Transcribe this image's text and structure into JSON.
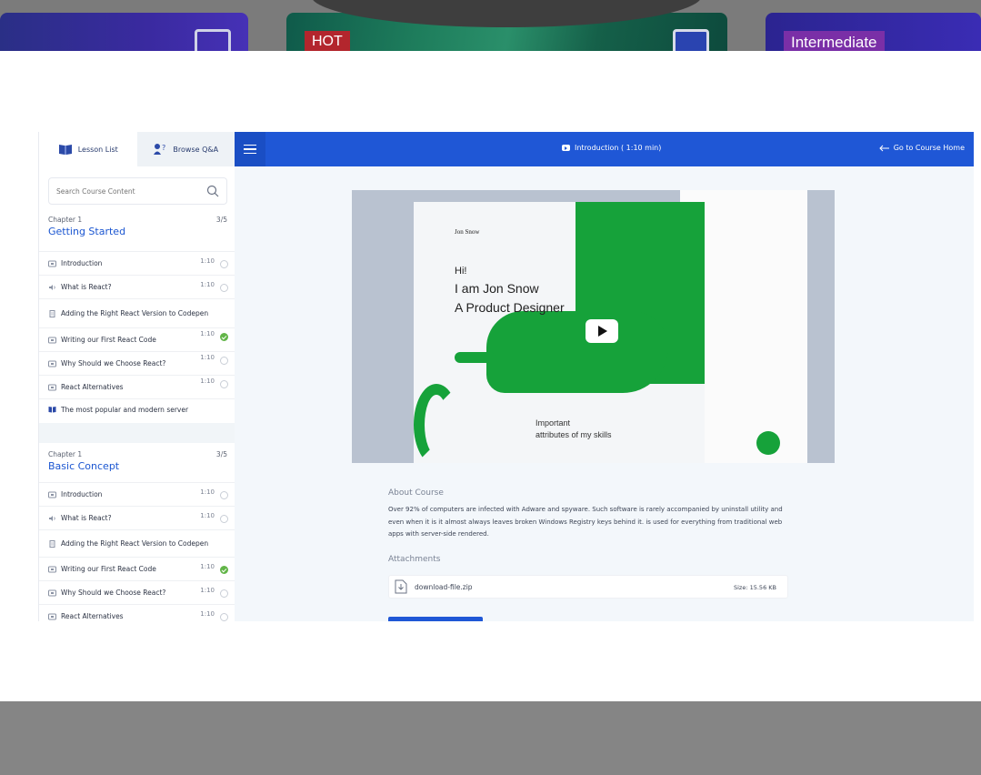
{
  "background": {
    "badges": {
      "hot": "HOT",
      "intermediate": "Intermediate"
    }
  },
  "tabs": [
    {
      "label": "Lesson List",
      "icon": "book-icon",
      "active": true
    },
    {
      "label": "Browse Q&A",
      "icon": "qa-icon",
      "active": false
    }
  ],
  "search": {
    "placeholder": "Search Course Content"
  },
  "chapters": [
    {
      "number": "Chapter 1",
      "count": "3/5",
      "title": "Getting Started",
      "lessons": [
        {
          "icon": "video-icon",
          "title": "Introduction",
          "time": "1:10",
          "done": false
        },
        {
          "icon": "audio-icon",
          "title": "What is React?",
          "time": "1:10",
          "done": false
        },
        {
          "icon": "file-icon",
          "title": "Adding the Right React Version to Codepen",
          "time": "",
          "done": null
        },
        {
          "icon": "video-icon",
          "title": "Writing our First React Code",
          "time": "1:10",
          "done": true
        },
        {
          "icon": "video-icon",
          "title": "Why Should we Choose React?",
          "time": "1:10",
          "done": false
        },
        {
          "icon": "video-icon",
          "title": "React Alternatives",
          "time": "1:10",
          "done": false
        },
        {
          "icon": "book-icon",
          "title": "The most popular and modern server",
          "time": "",
          "done": null
        }
      ]
    },
    {
      "number": "Chapter 1",
      "count": "3/5",
      "title": "Basic Concept",
      "lessons": [
        {
          "icon": "video-icon",
          "title": "Introduction",
          "time": "1:10",
          "done": false
        },
        {
          "icon": "audio-icon",
          "title": "What is React?",
          "time": "1:10",
          "done": false
        },
        {
          "icon": "file-icon",
          "title": "Adding the Right React Version to Codepen",
          "time": "",
          "done": null
        },
        {
          "icon": "video-icon",
          "title": "Writing our First React Code",
          "time": "1:10",
          "done": true
        },
        {
          "icon": "video-icon",
          "title": "Why Should we Choose React?",
          "time": "1:10",
          "done": false
        },
        {
          "icon": "video-icon",
          "title": "React Alternatives",
          "time": "1:10",
          "done": false
        }
      ]
    }
  ],
  "header": {
    "title": "Introduction ( 1:10 min)",
    "home_link": "Go to Course Home"
  },
  "video_preview": {
    "logo": "Jon Snow",
    "greeting": "Hi!",
    "name_line": "I am Jon Snow",
    "job_line": "A Product Designer",
    "section_line1": "Important",
    "section_line2": "attributes of my skills"
  },
  "about": {
    "title": "About Course",
    "text": "Over 92% of computers are infected with Adware and spyware. Such software is rarely accompanied by uninstall utility and even when it is it almost always leaves broken Windows Registry keys behind it. is used for everything from traditional web apps with server-side rendered."
  },
  "attachments": {
    "title": "Attachments",
    "file_name": "download-file.zip",
    "file_size": "Size: 15.56 KB"
  },
  "colors": {
    "primary": "#1f57d6",
    "chapter_title": "#1b56d1",
    "check_done": "#62b548",
    "video_green": "#16a23a"
  }
}
